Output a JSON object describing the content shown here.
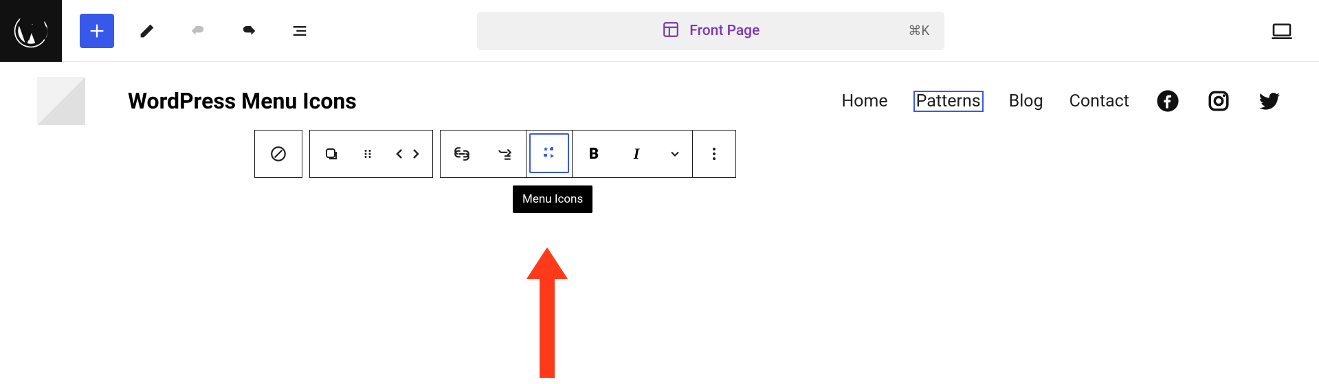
{
  "header": {
    "page_title": "Front Page",
    "keyboard_shortcut": "⌘K"
  },
  "site": {
    "title": "WordPress Menu Icons"
  },
  "nav": {
    "items": [
      {
        "label": "Home",
        "selected": false
      },
      {
        "label": "Patterns",
        "selected": true
      },
      {
        "label": "Blog",
        "selected": false
      },
      {
        "label": "Contact",
        "selected": false
      }
    ]
  },
  "tooltip": {
    "text": "Menu Icons"
  }
}
